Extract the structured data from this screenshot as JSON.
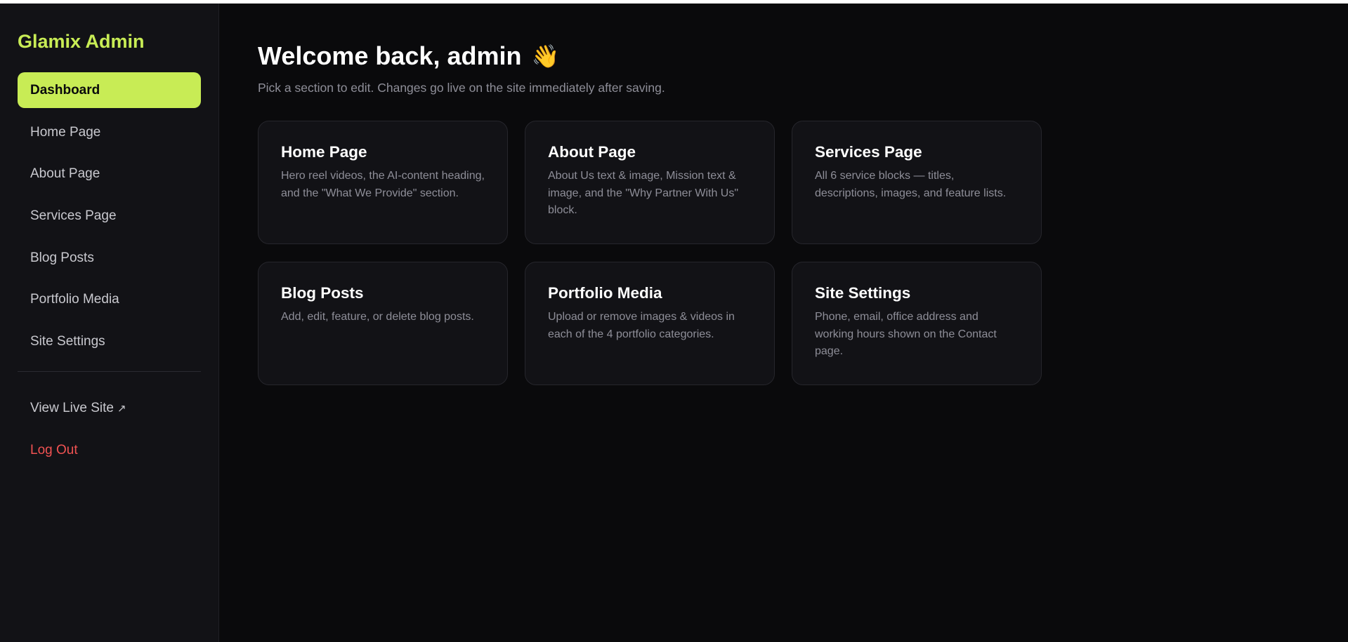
{
  "sidebar": {
    "brand": "Glamix Admin",
    "items": [
      {
        "label": "Dashboard"
      },
      {
        "label": "Home Page"
      },
      {
        "label": "About Page"
      },
      {
        "label": "Services Page"
      },
      {
        "label": "Blog Posts"
      },
      {
        "label": "Portfolio Media"
      },
      {
        "label": "Site Settings"
      }
    ],
    "view_live_label": "View Live Site",
    "external_glyph": "↗",
    "logout_label": "Log Out"
  },
  "main": {
    "title": "Welcome back, admin",
    "wave_glyph": "👋",
    "subtitle": "Pick a section to edit. Changes go live on the site immediately after saving.",
    "cards": [
      {
        "title": "Home Page",
        "description": "Hero reel videos, the AI-content heading, and the \"What We Provide\" section."
      },
      {
        "title": "About Page",
        "description": "About Us text & image, Mission text & image, and the \"Why Partner With Us\" block."
      },
      {
        "title": "Services Page",
        "description": "All 6 service blocks — titles, descriptions, images, and feature lists."
      },
      {
        "title": "Blog Posts",
        "description": "Add, edit, feature, or delete blog posts."
      },
      {
        "title": "Portfolio Media",
        "description": "Upload or remove images & videos in each of the 4 portfolio categories."
      },
      {
        "title": "Site Settings",
        "description": "Phone, email, office address and working hours shown on the Contact page."
      }
    ]
  },
  "colors": {
    "accent": "#c8ec55",
    "background": "#0a0a0c",
    "panel": "#121216",
    "danger": "#f05252",
    "muted_text": "#8e8e98"
  },
  "icons": {
    "wave": "waving-hand-icon",
    "external": "external-link-icon"
  }
}
